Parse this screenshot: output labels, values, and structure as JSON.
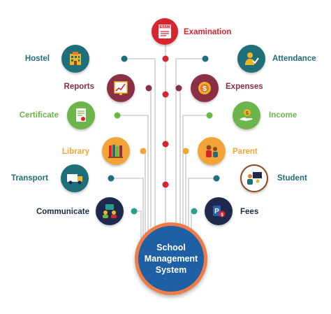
{
  "center": {
    "title": "School\nManagement\nSystem"
  },
  "colors": {
    "teal": "#1f6f7a",
    "maroon": "#8a2f46",
    "green": "#6bb54a",
    "orange": "#f2a536",
    "navy": "#1e2a4d",
    "red": "#d9232e",
    "hub_fill": "#1f5fa3",
    "hub_ring": "#ef7b47"
  },
  "top_module": {
    "label": "Examination",
    "icon": "exam-icon",
    "color": "#d9232e"
  },
  "left_modules": [
    {
      "label": "Hostel",
      "icon": "hostel-building-icon",
      "color": "#1f6f7a"
    },
    {
      "label": "Reports",
      "icon": "report-chart-icon",
      "color": "#8a2f46"
    },
    {
      "label": "Certificate",
      "icon": "certificate-icon",
      "color": "#6bb54a"
    },
    {
      "label": "Library",
      "icon": "library-books-icon",
      "color": "#f2a536"
    },
    {
      "label": "Transport",
      "icon": "transport-truck-icon",
      "color": "#1f6f7a"
    },
    {
      "label": "Communicate",
      "icon": "communicate-people-icon",
      "color": "#1e2a4d"
    }
  ],
  "right_modules": [
    {
      "label": "Attendance",
      "icon": "attendance-person-icon",
      "color": "#1f6f7a"
    },
    {
      "label": "Expenses",
      "icon": "expenses-coins-icon",
      "color": "#8a2f46"
    },
    {
      "label": "Income",
      "icon": "income-money-icon",
      "color": "#6bb54a"
    },
    {
      "label": "Parent",
      "icon": "parent-family-icon",
      "color": "#f2a536"
    },
    {
      "label": "Student",
      "icon": "student-teacher-icon",
      "color": "#1f6f7a"
    },
    {
      "label": "Fees",
      "icon": "fees-payment-icon",
      "color": "#1e2a4d"
    }
  ]
}
